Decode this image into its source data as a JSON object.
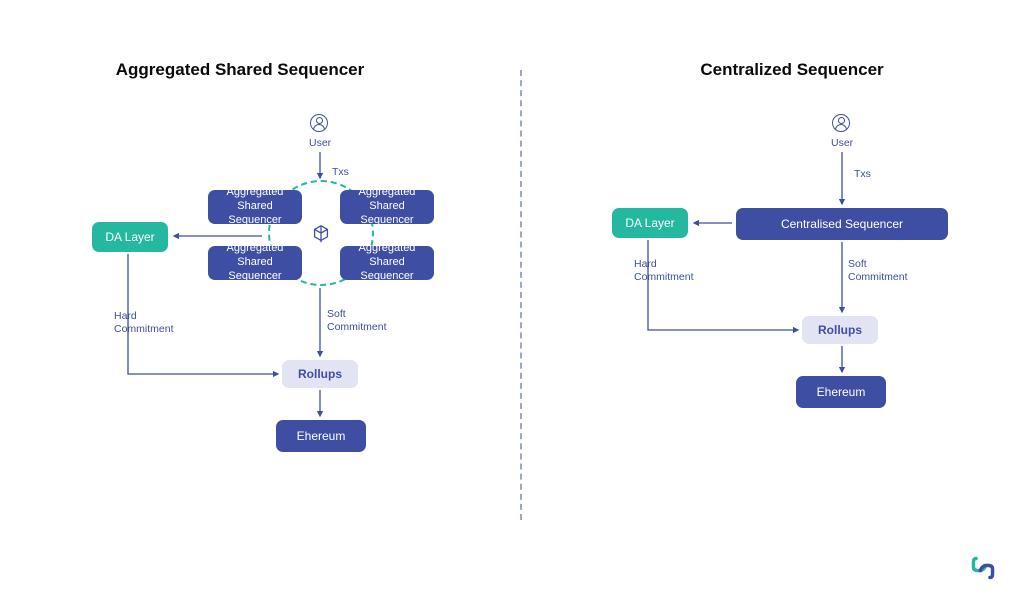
{
  "left": {
    "title": "Aggregated Shared Sequencer",
    "user": "User",
    "txs": "Txs",
    "seq": "Aggregated Shared Sequencer",
    "da": "DA Layer",
    "hard": "Hard Commitment",
    "soft": "Soft Commitment",
    "rollups": "Rollups",
    "eth": "Ehereum"
  },
  "right": {
    "title": "Centralized Sequencer",
    "user": "User",
    "txs": "Txs",
    "seq": "Centralised Sequencer",
    "da": "DA Layer",
    "hard": "Hard Commitment",
    "soft": "Soft Commitment",
    "rollups": "Rollups",
    "eth": "Ehereum"
  },
  "colors": {
    "navy": "#3d4ea3",
    "teal": "#25b8a0",
    "lavender": "#e3e4f3"
  }
}
